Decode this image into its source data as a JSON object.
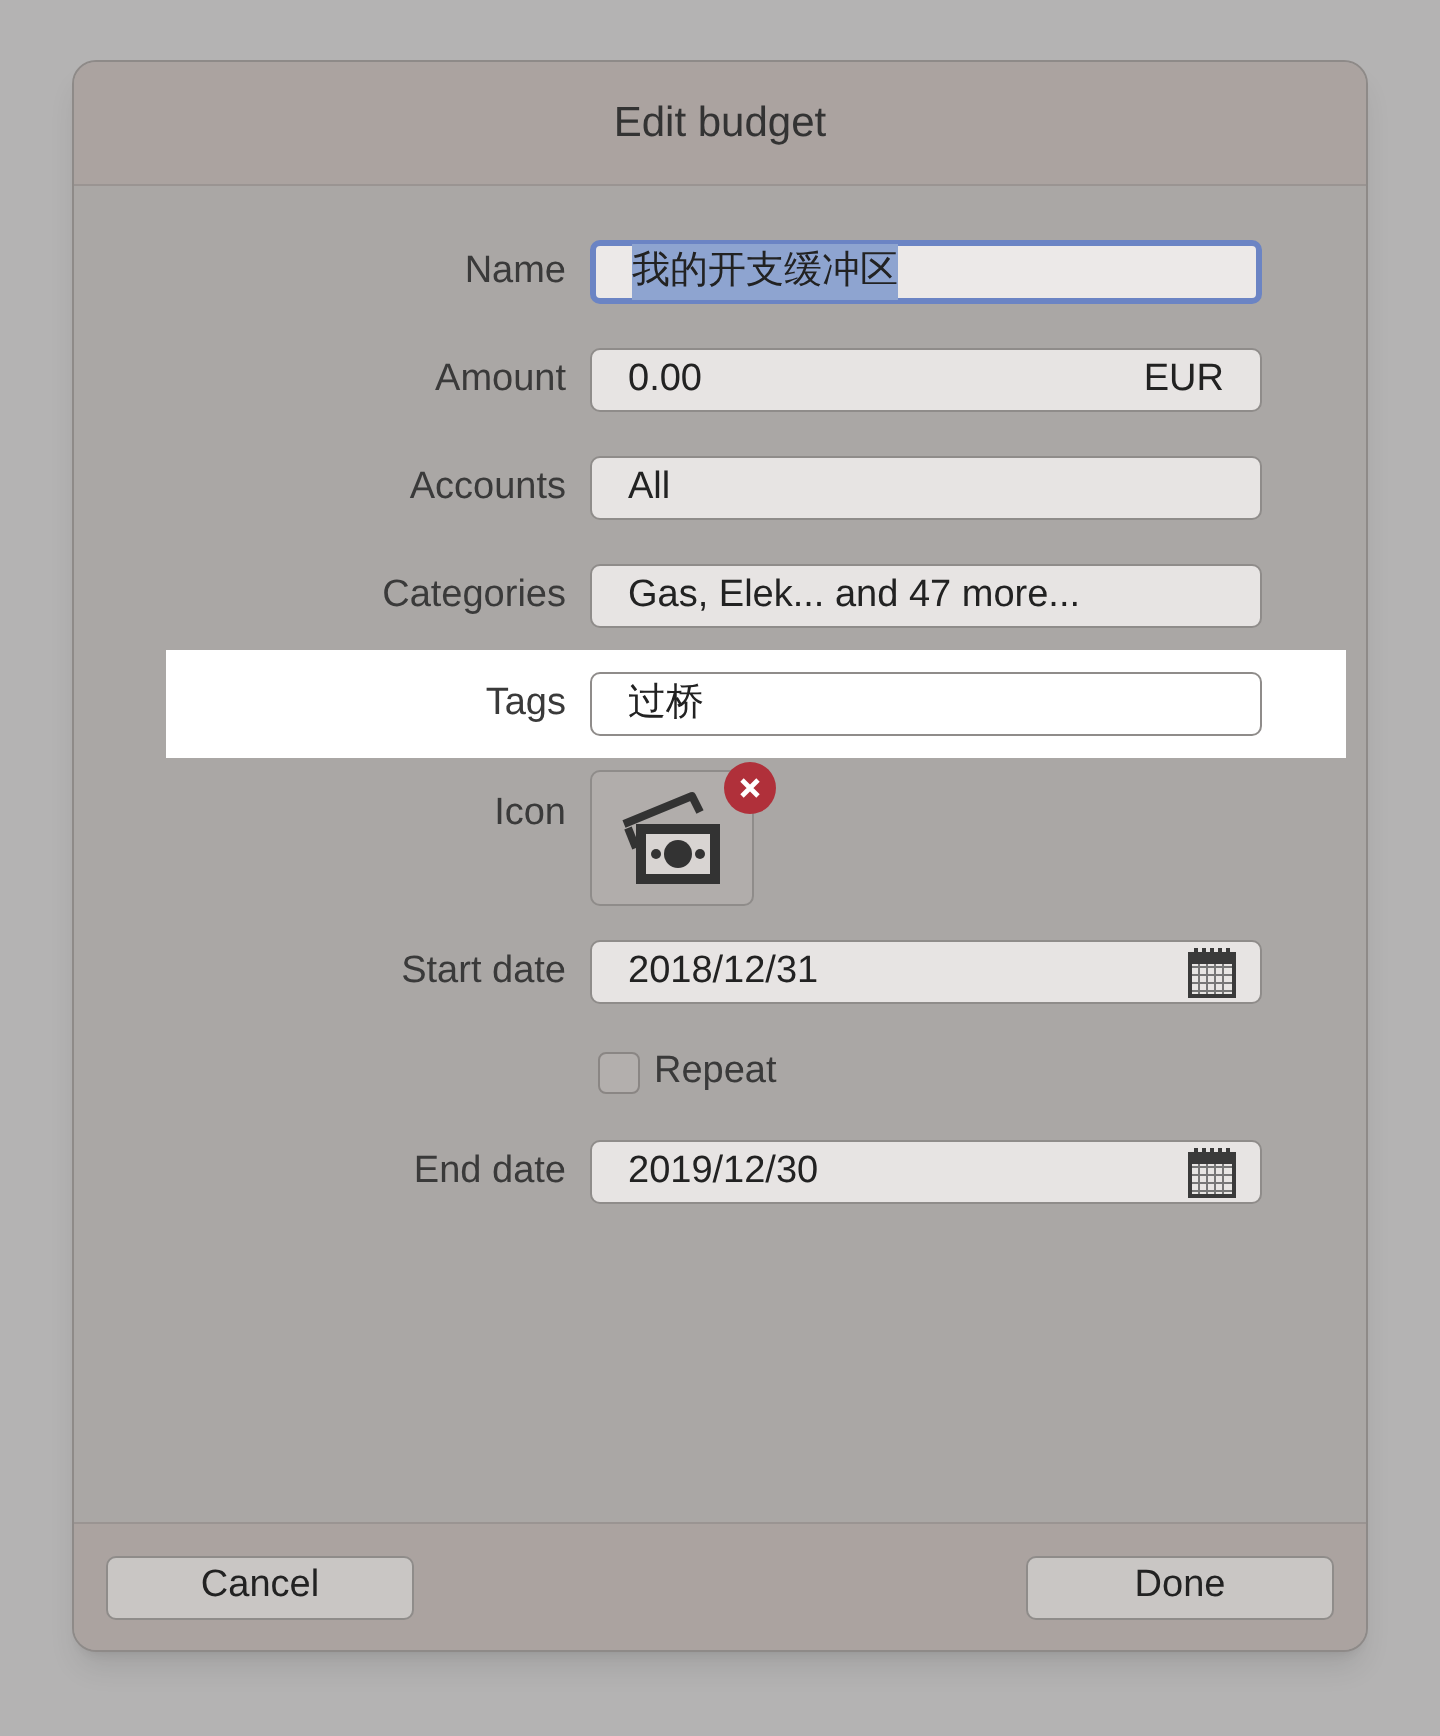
{
  "dialog": {
    "title": "Edit budget"
  },
  "fields": [
    {
      "kind": "text",
      "label": "Name",
      "value": "我的开支缓冲区",
      "focused": true,
      "text_selected": true,
      "highlighted": false
    },
    {
      "kind": "amount",
      "label": "Amount",
      "value": "0.00",
      "currency": "EUR",
      "focused": false,
      "text_selected": false,
      "highlighted": false
    },
    {
      "kind": "popup",
      "label": "Accounts",
      "value": "All",
      "focused": false,
      "highlighted": false
    },
    {
      "kind": "popup",
      "label": "Categories",
      "value": "Gas, Elek... and 47 more...",
      "focused": false,
      "highlighted": false
    },
    {
      "kind": "text",
      "label": "Tags",
      "value": "过桥",
      "focused": false,
      "text_selected": false,
      "highlighted": true
    },
    {
      "kind": "icon",
      "label": "Icon",
      "removable": true,
      "focused": false,
      "highlighted": false
    },
    {
      "kind": "date",
      "label": "Start date",
      "value": "2018/12/31",
      "focused": false,
      "text_selected": false,
      "highlighted": false
    },
    {
      "kind": "checkbox",
      "label": "Repeat",
      "checked": false,
      "highlighted": false
    },
    {
      "kind": "date",
      "label": "End date",
      "value": "2019/12/30",
      "focused": false,
      "text_selected": false,
      "highlighted": false
    }
  ],
  "buttons": [
    {
      "label": "Cancel"
    },
    {
      "label": "Done"
    }
  ]
}
